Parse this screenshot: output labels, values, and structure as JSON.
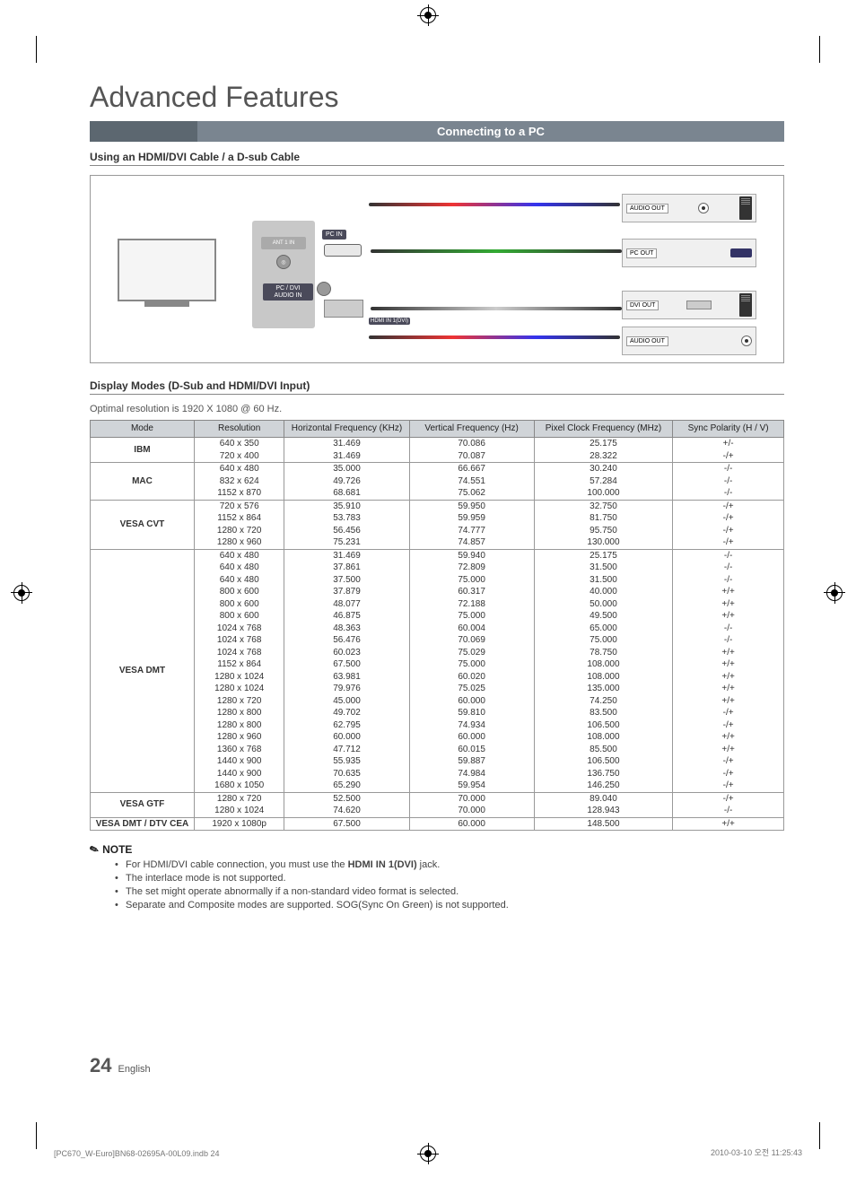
{
  "title": "Advanced Features",
  "section_bar": "Connecting to a PC",
  "sub1": "Using an HDMI/DVI Cable / a D-sub Cable",
  "diagram": {
    "ant": "ANT 1 IN",
    "pcin": "PC IN",
    "pcdvi": "PC / DVI AUDIO IN",
    "hdmi1": "HDMI IN 1(DVI)",
    "audio_out": "AUDIO OUT",
    "pc_out": "PC OUT",
    "dvi_out": "DVI OUT"
  },
  "sub2": "Display Modes (D-Sub and HDMI/DVI Input)",
  "optimal": "Optimal resolution is 1920 X 1080 @ 60 Hz.",
  "headers": {
    "mode": "Mode",
    "res": "Resolution",
    "hfreq": "Horizontal Frequency (KHz)",
    "vfreq": "Vertical Frequency (Hz)",
    "pclk": "Pixel Clock Frequency (MHz)",
    "sync": "Sync Polarity (H / V)"
  },
  "groups": [
    {
      "mode": "IBM",
      "rows": [
        {
          "res": "640 x 350",
          "h": "31.469",
          "v": "70.086",
          "p": "25.175",
          "s": "+/-"
        },
        {
          "res": "720 x 400",
          "h": "31.469",
          "v": "70.087",
          "p": "28.322",
          "s": "-/+"
        }
      ]
    },
    {
      "mode": "MAC",
      "rows": [
        {
          "res": "640 x 480",
          "h": "35.000",
          "v": "66.667",
          "p": "30.240",
          "s": "-/-"
        },
        {
          "res": "832 x 624",
          "h": "49.726",
          "v": "74.551",
          "p": "57.284",
          "s": "-/-"
        },
        {
          "res": "1152 x 870",
          "h": "68.681",
          "v": "75.062",
          "p": "100.000",
          "s": "-/-"
        }
      ]
    },
    {
      "mode": "VESA CVT",
      "rows": [
        {
          "res": "720 x 576",
          "h": "35.910",
          "v": "59.950",
          "p": "32.750",
          "s": "-/+"
        },
        {
          "res": "1152 x 864",
          "h": "53.783",
          "v": "59.959",
          "p": "81.750",
          "s": "-/+"
        },
        {
          "res": "1280 x 720",
          "h": "56.456",
          "v": "74.777",
          "p": "95.750",
          "s": "-/+"
        },
        {
          "res": "1280 x 960",
          "h": "75.231",
          "v": "74.857",
          "p": "130.000",
          "s": "-/+"
        }
      ]
    },
    {
      "mode": "VESA DMT",
      "rows": [
        {
          "res": "640 x 480",
          "h": "31.469",
          "v": "59.940",
          "p": "25.175",
          "s": "-/-"
        },
        {
          "res": "640 x 480",
          "h": "37.861",
          "v": "72.809",
          "p": "31.500",
          "s": "-/-"
        },
        {
          "res": "640 x 480",
          "h": "37.500",
          "v": "75.000",
          "p": "31.500",
          "s": "-/-"
        },
        {
          "res": "800 x 600",
          "h": "37.879",
          "v": "60.317",
          "p": "40.000",
          "s": "+/+"
        },
        {
          "res": "800 x 600",
          "h": "48.077",
          "v": "72.188",
          "p": "50.000",
          "s": "+/+"
        },
        {
          "res": "800 x 600",
          "h": "46.875",
          "v": "75.000",
          "p": "49.500",
          "s": "+/+"
        },
        {
          "res": "1024 x 768",
          "h": "48.363",
          "v": "60.004",
          "p": "65.000",
          "s": "-/-"
        },
        {
          "res": "1024 x 768",
          "h": "56.476",
          "v": "70.069",
          "p": "75.000",
          "s": "-/-"
        },
        {
          "res": "1024 x 768",
          "h": "60.023",
          "v": "75.029",
          "p": "78.750",
          "s": "+/+"
        },
        {
          "res": "1152 x 864",
          "h": "67.500",
          "v": "75.000",
          "p": "108.000",
          "s": "+/+"
        },
        {
          "res": "1280 x 1024",
          "h": "63.981",
          "v": "60.020",
          "p": "108.000",
          "s": "+/+"
        },
        {
          "res": "1280 x 1024",
          "h": "79.976",
          "v": "75.025",
          "p": "135.000",
          "s": "+/+"
        },
        {
          "res": "1280 x 720",
          "h": "45.000",
          "v": "60.000",
          "p": "74.250",
          "s": "+/+"
        },
        {
          "res": "1280 x 800",
          "h": "49.702",
          "v": "59.810",
          "p": "83.500",
          "s": "-/+"
        },
        {
          "res": "1280 x 800",
          "h": "62.795",
          "v": "74.934",
          "p": "106.500",
          "s": "-/+"
        },
        {
          "res": "1280 x 960",
          "h": "60.000",
          "v": "60.000",
          "p": "108.000",
          "s": "+/+"
        },
        {
          "res": "1360 x 768",
          "h": "47.712",
          "v": "60.015",
          "p": "85.500",
          "s": "+/+"
        },
        {
          "res": "1440 x 900",
          "h": "55.935",
          "v": "59.887",
          "p": "106.500",
          "s": "-/+"
        },
        {
          "res": "1440 x 900",
          "h": "70.635",
          "v": "74.984",
          "p": "136.750",
          "s": "-/+"
        },
        {
          "res": "1680 x 1050",
          "h": "65.290",
          "v": "59.954",
          "p": "146.250",
          "s": "-/+"
        }
      ]
    },
    {
      "mode": "VESA GTF",
      "rows": [
        {
          "res": "1280 x 720",
          "h": "52.500",
          "v": "70.000",
          "p": "89.040",
          "s": "-/+"
        },
        {
          "res": "1280 x 1024",
          "h": "74.620",
          "v": "70.000",
          "p": "128.943",
          "s": "-/-"
        }
      ]
    },
    {
      "mode": "VESA DMT / DTV CEA",
      "rows": [
        {
          "res": "1920 x 1080p",
          "h": "67.500",
          "v": "60.000",
          "p": "148.500",
          "s": "+/+"
        }
      ]
    }
  ],
  "note_label": "NOTE",
  "notes": [
    {
      "pre": "For HDMI/DVI cable connection, you must use the ",
      "hl": "HDMI IN 1(DVI)",
      "post": " jack."
    },
    {
      "pre": "The interlace mode is not supported.",
      "hl": "",
      "post": ""
    },
    {
      "pre": "The set might operate abnormally if a non-standard video format is selected.",
      "hl": "",
      "post": ""
    },
    {
      "pre": "Separate and Composite modes are supported. SOG(Sync On Green) is not supported.",
      "hl": "",
      "post": ""
    }
  ],
  "footer": {
    "page": "24",
    "lang": "English"
  },
  "indb": "[PC670_W-Euro]BN68-02695A-00L09.indb   24",
  "timestamp": "2010-03-10   오전 11:25:43"
}
